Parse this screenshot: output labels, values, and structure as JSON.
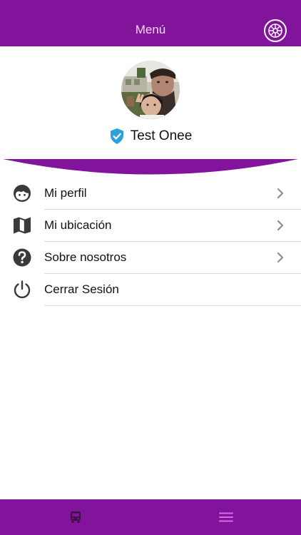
{
  "header": {
    "title": "Menú",
    "settings_icon": "settings-wheel-icon"
  },
  "profile": {
    "name": "Test Onee",
    "verified_icon": "verified-shield-icon"
  },
  "menu": {
    "items": [
      {
        "label": "Mi perfil",
        "icon": "face-icon",
        "has_chevron": true
      },
      {
        "label": "Mi ubicación",
        "icon": "map-icon",
        "has_chevron": true
      },
      {
        "label": "Sobre nosotros",
        "icon": "question-icon",
        "has_chevron": true
      },
      {
        "label": "Cerrar Sesión",
        "icon": "power-icon",
        "has_chevron": false
      }
    ]
  },
  "tabbar": {
    "tabs": [
      {
        "icon": "bus-icon",
        "active": false
      },
      {
        "icon": "hamburger-menu-icon",
        "active": true
      }
    ]
  },
  "colors": {
    "brand": "#82149b",
    "header_text": "#f0d8f6",
    "verified": "#2d9fd9",
    "active_tab": "#d46ce8",
    "inactive_tab": "#3d1147"
  }
}
